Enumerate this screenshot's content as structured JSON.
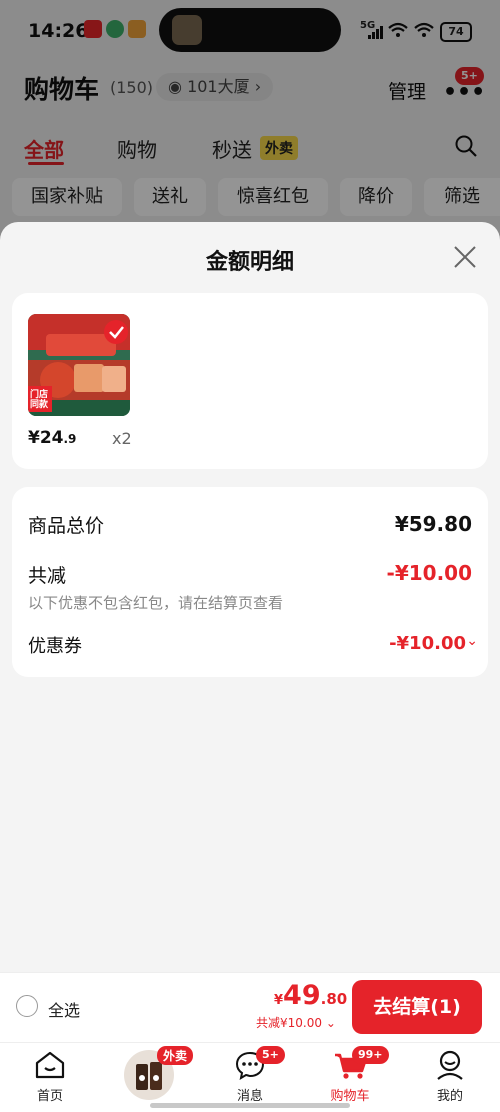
{
  "status_bar": {
    "time": "14:26",
    "network": "5G",
    "battery": "74"
  },
  "header": {
    "title": "购物车",
    "count": "(150)",
    "address": "101大厦",
    "manage": "管理",
    "more_badge": "5+"
  },
  "tabs": [
    {
      "label": "全部"
    },
    {
      "label": "购物"
    },
    {
      "label": "秒送"
    }
  ],
  "tab_tag": "外卖",
  "chips": [
    "国家补贴",
    "送礼",
    "惊喜红包",
    "降价",
    "筛选"
  ],
  "sheet": {
    "title": "金额明细",
    "product": {
      "img_tag": "门店同款",
      "price_int": "¥24",
      "price_dec": ".9",
      "qty": "x2"
    },
    "rows": {
      "total_label": "商品总价",
      "total_value": "¥59.80",
      "reduce_label": "共减",
      "reduce_value": "-¥10.00",
      "note": "以下优惠不包含红包，请在结算页查看",
      "coupon_label": "优惠券",
      "coupon_value": "-¥10.00"
    }
  },
  "checkout": {
    "select_all": "全选",
    "currency": "¥",
    "total_int": "49",
    "total_dec": ".80",
    "reduce": "共减¥10.00",
    "button": "去结算(1)"
  },
  "tabbar": [
    {
      "label": "首页"
    },
    {
      "label": "",
      "tag": "外卖"
    },
    {
      "label": "消息",
      "badge": "5+"
    },
    {
      "label": "购物车",
      "badge": "99+"
    },
    {
      "label": "我的"
    }
  ],
  "colors": {
    "accent": "#e5232a",
    "sheet_bg": "#f4f4f4",
    "tag_yellow": "#f7d84a"
  }
}
